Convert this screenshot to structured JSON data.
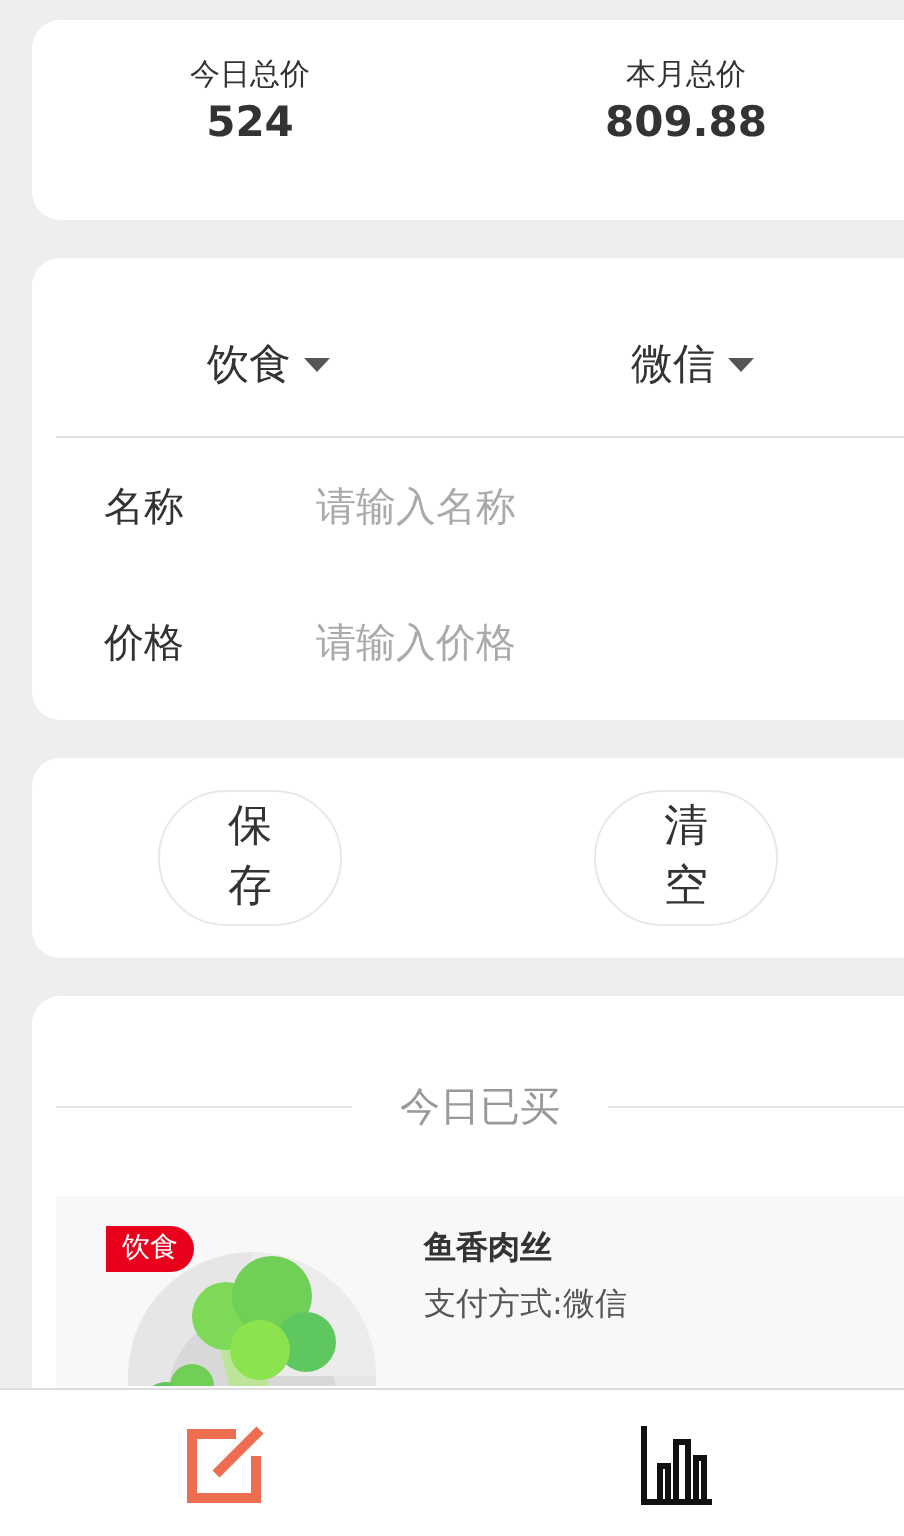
{
  "summary": [
    {
      "label": "今日总价",
      "value": "524"
    },
    {
      "label": "本月总价",
      "value": "809.88"
    }
  ],
  "pickers": [
    {
      "value": "饮食"
    },
    {
      "value": "微信"
    }
  ],
  "fields": [
    {
      "label": "名称",
      "placeholder": "请输入名称"
    },
    {
      "label": "价格",
      "placeholder": "请输入价格"
    }
  ],
  "buttons": [
    "保存",
    "清空"
  ],
  "today": {
    "title": "今日已买",
    "items": [
      {
        "kind": "picture",
        "tag": "饮食",
        "name": "鱼香肉丝",
        "payment": "支付方式:微信"
      }
    ]
  },
  "tabbar": [
    {
      "kind": "edit",
      "selected": true
    },
    {
      "kind": "chart",
      "selected": false
    }
  ]
}
